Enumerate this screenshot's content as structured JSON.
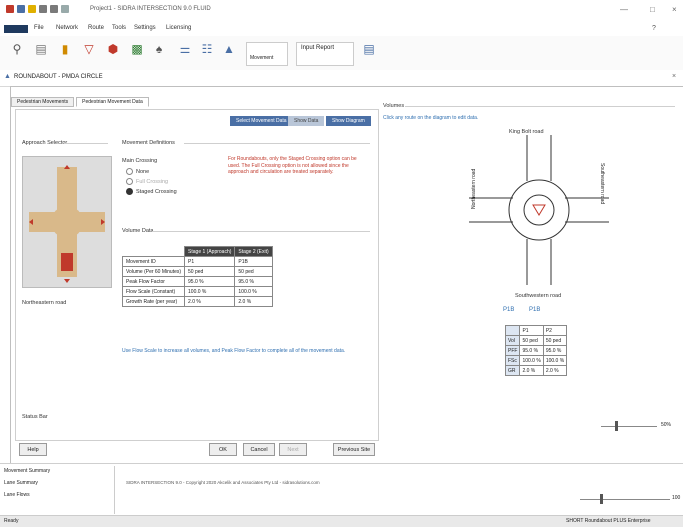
{
  "app": {
    "title": "Project1 - SIDRA INTERSECTION 9.0 FLUID"
  },
  "menu": [
    "File",
    "Network",
    "Route",
    "Tools",
    "Settings",
    "Licensing"
  ],
  "ribbon": {
    "input_report_label": "Input Report",
    "movement_label": "Movement"
  },
  "doc": {
    "title": "ROUNDABOUT - PMDA CIRCLE"
  },
  "tabs": [
    "Pedestrian Movements",
    "Pedestrian Movement Data"
  ],
  "dialog": {
    "section_buttons": [
      "Select Movement Data",
      "Show Data",
      "Show Diagram"
    ],
    "approach_selector_label": "Approach Selector",
    "approach_name": "Northeastern road",
    "movement_definitions_label": "Movement Definitions",
    "crossing_options": [
      "Main Crossing",
      "None",
      "Full Crossing",
      "Staged Crossing"
    ],
    "definitions_note": "For Roundabouts, only the Staged Crossing option can be used. The Full Crossing option is not allowed since the approach and circulation are treated separately.",
    "volume_data_label": "Volume Data",
    "vol_headers": [
      "",
      "Stage 1 (Approach)",
      "Stage 2 (Exit)"
    ],
    "vol_rows": [
      [
        "Movement ID",
        "P1",
        "P1B"
      ],
      [
        "Volume (Per 60 Minutes)",
        "50 ped",
        "50 ped"
      ],
      [
        "Peak Flow Factor",
        "95.0 %",
        "95.0 %"
      ],
      [
        "Flow Scale (Constant)",
        "100.0 %",
        "100.0 %"
      ],
      [
        "Growth Rate (per year)",
        "2.0 %",
        "2.0 %"
      ]
    ],
    "volume_note": "Use Flow Scale to increase all volumes, and Peak Flow Factor to complete all of the movement data.",
    "status_label": "Status Bar",
    "buttons": {
      "help": "Help",
      "ok": "OK",
      "cancel": "Cancel",
      "next": "Next",
      "previous": "Previous Site"
    }
  },
  "diagram": {
    "header": "Volumes",
    "note": "Click any route on the diagram to edit data.",
    "top_road": "King Bolt road",
    "left_road": "Northeastern road",
    "right_road": "Southeastern road",
    "bottom_road": "Southwestern road",
    "movement_buttons": [
      "P1B",
      "P1B"
    ],
    "res_headers": [
      "",
      "P1",
      "P2"
    ],
    "res_rows": [
      [
        "Vol",
        "50 ped",
        "50 ped"
      ],
      [
        "PFF",
        "95.0 %",
        "95.0 %"
      ],
      [
        "FSc",
        "100.0 %",
        "100.0 %"
      ],
      [
        "GR",
        "2.0 %",
        "2.0 %"
      ]
    ],
    "zoom": "50%"
  },
  "bottom": {
    "tree": [
      "Movement Summary",
      "Lane Summary",
      "Lane Flows"
    ],
    "log": "SIDRA INTERSECTION 9.0 - Copyright 2020 Akcelik and Associates Pty Ltd - sidrasolutions.com",
    "zoom": "100"
  },
  "status": {
    "left": "Ready",
    "right": "SHORT Roundabout PLUS Enterprise"
  },
  "colors": {
    "accent": "#4a6fa5",
    "road": "#d9b98a",
    "red": "#c0392b"
  }
}
